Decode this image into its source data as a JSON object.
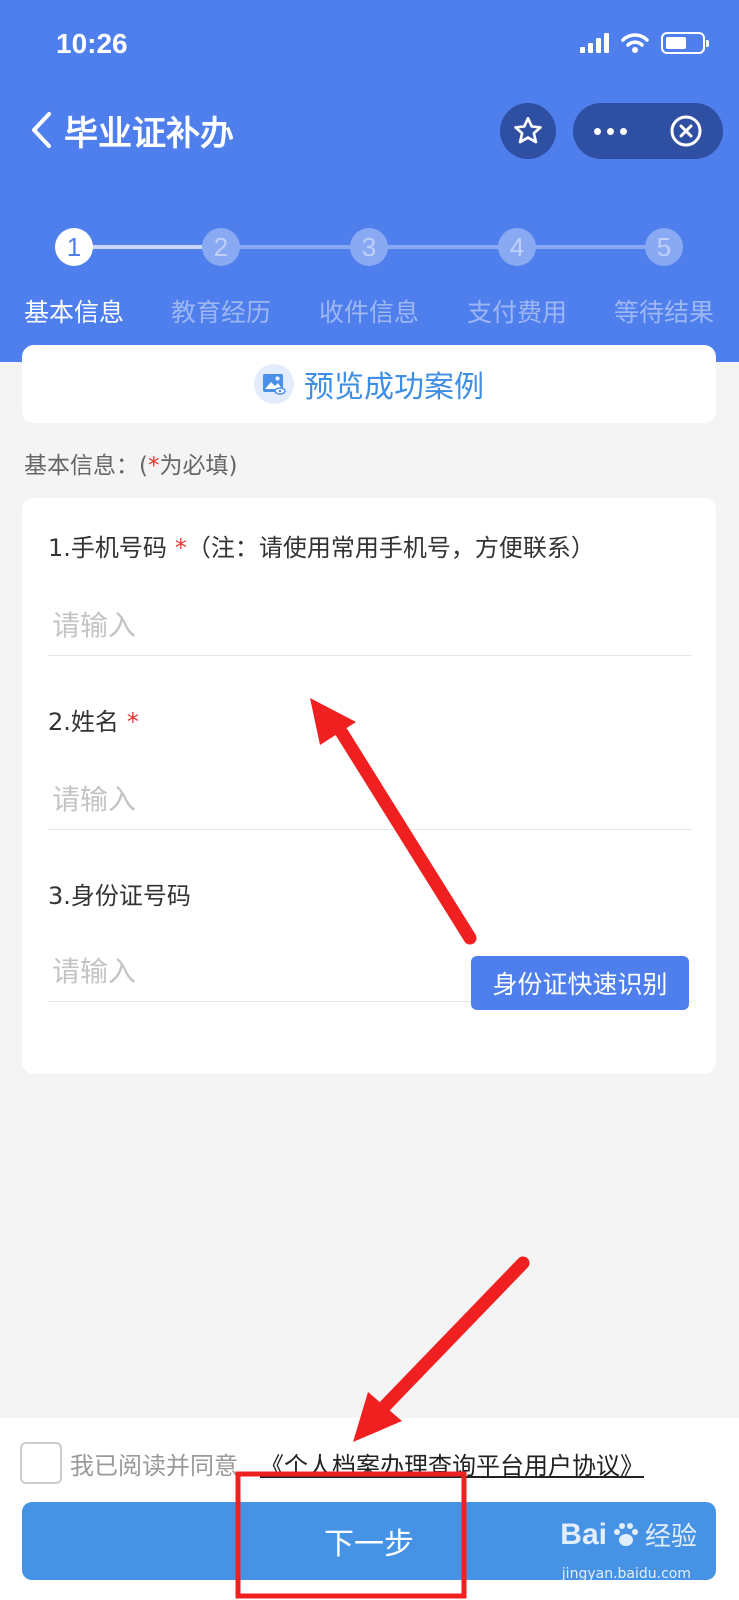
{
  "status_bar": {
    "time": "10:26"
  },
  "header": {
    "title": "毕业证补办"
  },
  "steps": [
    {
      "number": "1",
      "label": "基本信息",
      "active": true
    },
    {
      "number": "2",
      "label": "教育经历",
      "active": false
    },
    {
      "number": "3",
      "label": "收件信息",
      "active": false
    },
    {
      "number": "4",
      "label": "支付费用",
      "active": false
    },
    {
      "number": "5",
      "label": "等待结果",
      "active": false
    }
  ],
  "preview": {
    "label": "预览成功案例"
  },
  "section_note": {
    "prefix": "基本信息：(",
    "star": "*",
    "suffix": "为必填)"
  },
  "form": {
    "phone": {
      "label": "1.手机号码",
      "star": "*",
      "hint": "（注：请使用常用手机号，方便联系）",
      "placeholder": "请输入"
    },
    "name": {
      "label": "2.姓名",
      "star": "*",
      "placeholder": "请输入"
    },
    "id_number": {
      "label": "3.身份证号码",
      "placeholder": "请输入",
      "ocr_button": "身份证快速识别"
    }
  },
  "agreement": {
    "text": "我已阅读并同意",
    "link": "《个人档案办理查询平台用户协议》"
  },
  "next_button": {
    "label": "下一步"
  },
  "watermark": {
    "brand": "Bai",
    "brand_tail": "经验",
    "url": "jingyan.baidu.com"
  },
  "colors": {
    "primary": "#4f7fec",
    "required": "#e33333",
    "button": "#4693e6",
    "annotation": "#f02020"
  }
}
